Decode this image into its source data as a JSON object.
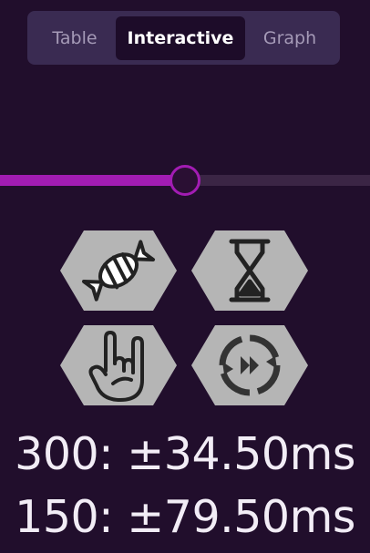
{
  "tabs": [
    {
      "label": "Table",
      "active": false
    },
    {
      "label": "Interactive",
      "active": true
    },
    {
      "label": "Graph",
      "active": false
    }
  ],
  "slider": {
    "value_fraction": 0.5,
    "accent": "#a21cb3"
  },
  "buttons": [
    {
      "icon": "candy-icon"
    },
    {
      "icon": "hourglass-icon"
    },
    {
      "icon": "rock-hand-icon"
    },
    {
      "icon": "cycle-fast-forward-icon"
    }
  ],
  "stats": [
    {
      "text": "300: ±34.50ms"
    },
    {
      "text": "150: ±79.50ms"
    }
  ]
}
